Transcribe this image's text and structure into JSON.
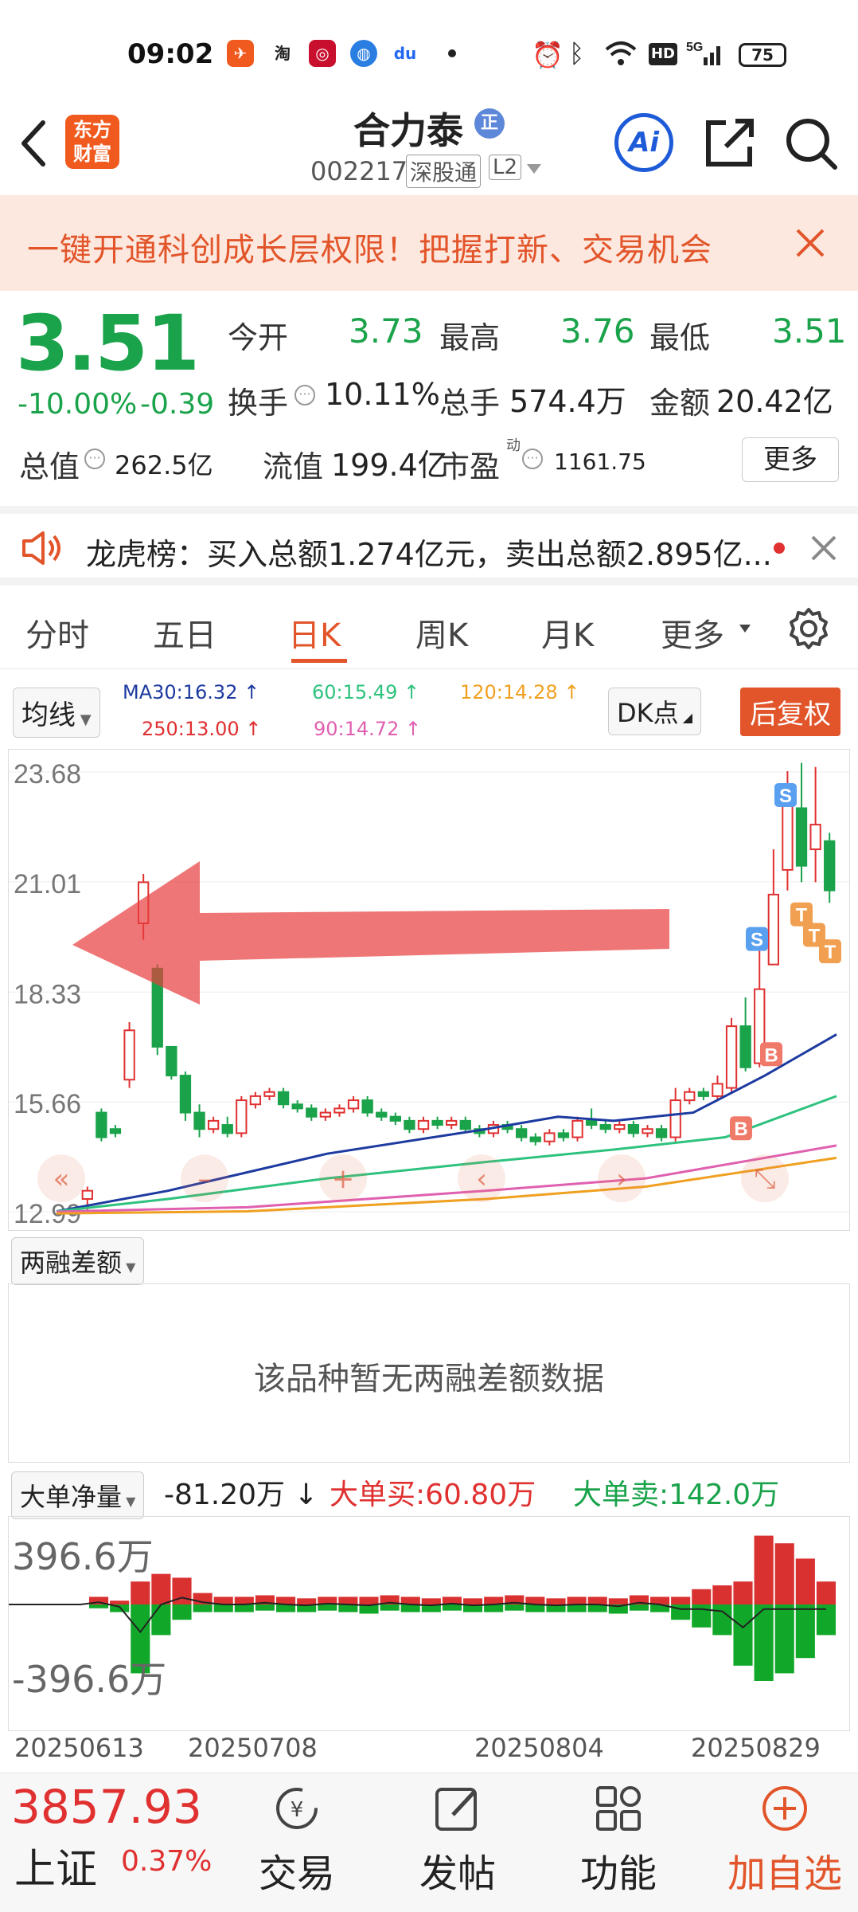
{
  "status_bar": {
    "time": "09:02",
    "battery": "75"
  },
  "header": {
    "brand_logo_text": "东方财富",
    "stock_name": "合力泰",
    "stock_tag": "正",
    "stock_code": "002217",
    "market_tag": "深股通",
    "level_tag": "L2",
    "ai_label": "Ai"
  },
  "banner": {
    "text": "一键开通科创成长层权限！把握打新、交易机会"
  },
  "quote": {
    "price": "3.51",
    "change_pct": "-10.00%",
    "change": "-0.39",
    "open_label": "今开",
    "open": "3.73",
    "high_label": "最高",
    "high": "3.76",
    "low_label": "最低",
    "low": "3.51",
    "turnover_label": "换手",
    "turnover": "10.11%",
    "volume_label": "总手",
    "volume": "574.4万",
    "amount_label": "金额",
    "amount": "20.42亿",
    "mktcap_label": "总值",
    "mktcap": "262.5亿",
    "float_label": "流值",
    "float": "199.4亿",
    "pe_label": "市盈",
    "pe_sup": "动",
    "pe": "1161.75",
    "more_label": "更多"
  },
  "lhb": {
    "text": "龙虎榜：买入总额1.274亿元，卖出总额2.895亿..."
  },
  "tabs": [
    "分时",
    "五日",
    "日K",
    "周K",
    "月K",
    "更多"
  ],
  "active_tab": "日K",
  "indicators": {
    "ma_select": "均线",
    "ma30": "MA30:16.32",
    "ma60": "60:15.49",
    "ma120": "120:14.28",
    "ma250": "250:13.00",
    "ma90": "90:14.72",
    "dk_label": "DK点",
    "adjust_label": "后复权",
    "colors": {
      "ma30": "#1d3aa0",
      "ma60": "#2ec27e",
      "ma120": "#f0a020",
      "ma250": "#e03030",
      "ma90": "#e060b0"
    }
  },
  "kline": {
    "y_ticks": [
      "23.68",
      "21.01",
      "18.33",
      "15.66",
      "12.99"
    ],
    "ylim": [
      12.99,
      23.68
    ],
    "signal_labels": {
      "buy": "B",
      "sell": "S",
      "take": "T"
    }
  },
  "margin": {
    "select": "两融差额",
    "empty_text": "该品种暂无两融差额数据"
  },
  "volume": {
    "select": "大单净量",
    "net_value": "-81.20万",
    "buy_text": "大单买:60.80万",
    "sell_text": "大单卖:142.0万",
    "y_top": "396.6万",
    "y_bottom": "-396.6万",
    "dates": [
      "20250613",
      "20250708",
      "20250804",
      "20250829"
    ]
  },
  "bottom_bar": {
    "index_value": "3857.93",
    "index_name": "上证",
    "index_change": "0.37%",
    "trade": "交易",
    "post": "发帖",
    "func": "功能",
    "add": "加自选"
  }
}
